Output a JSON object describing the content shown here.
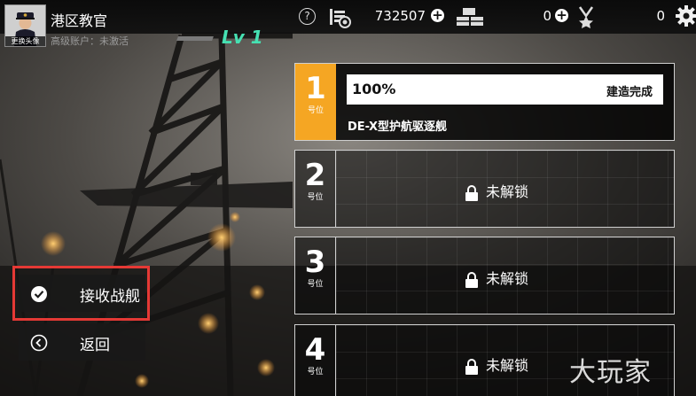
{
  "player": {
    "name": "港区教官",
    "avatar_caption": "更换头像",
    "account_status": "高级账户：未激活",
    "level": "Lv 1"
  },
  "resources": {
    "help_symbol": "?",
    "coins": "732507",
    "supplies": "0",
    "medals": "0",
    "plus_symbol": "+"
  },
  "slots": [
    {
      "number": "1",
      "unit": "号位",
      "state": "building",
      "progress": "100%",
      "progress_fraction": 1.0,
      "status": "建造完成",
      "ship_name": "DE-X型护航驱逐舰"
    },
    {
      "number": "2",
      "unit": "号位",
      "state": "locked",
      "locked_label": "未解锁"
    },
    {
      "number": "3",
      "unit": "号位",
      "state": "locked",
      "locked_label": "未解锁"
    },
    {
      "number": "4",
      "unit": "号位",
      "state": "locked",
      "locked_label": "未解锁"
    }
  ],
  "actions": {
    "receive_label": "接收战舰",
    "back_label": "返回"
  },
  "watermark": "大玩家",
  "colors": {
    "active_slot": "#f5a623",
    "level": "#46e0b2",
    "highlight": "#e53935"
  }
}
